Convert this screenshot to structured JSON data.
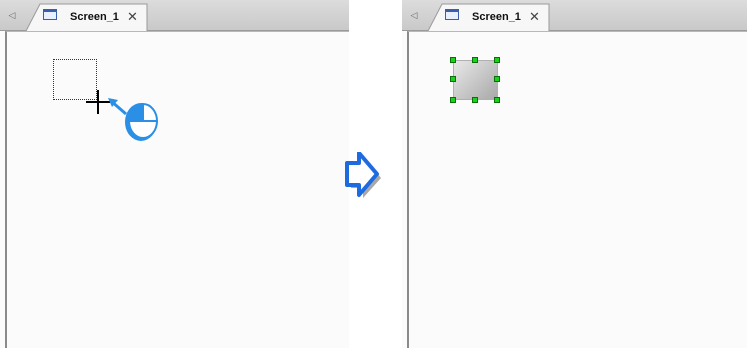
{
  "before_panel": {
    "tab": {
      "label": "Screen_1",
      "close_glyph": "✕",
      "scroll_glyph": "◁"
    }
  },
  "after_panel": {
    "tab": {
      "label": "Screen_1",
      "close_glyph": "✕",
      "scroll_glyph": "◁"
    }
  },
  "colors": {
    "accent_blue": "#2b8fe6",
    "handle_green": "#19d219",
    "object_gray": "#c4c4c4"
  },
  "icons": [
    "screen-icon",
    "close-icon",
    "crosshair-cursor-icon",
    "mouse-click-icon",
    "transition-arrow-icon",
    "selection-handle-icon"
  ]
}
